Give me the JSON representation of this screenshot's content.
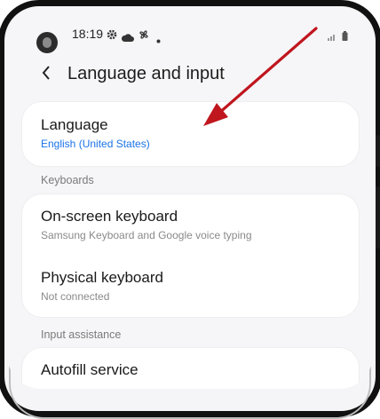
{
  "status_bar": {
    "time": "18:19",
    "icons": [
      "gear-icon",
      "cloud-icon",
      "fan-icon",
      "dot-icon"
    ],
    "right_icons": [
      "signal-icon",
      "battery-icon"
    ]
  },
  "header": {
    "back_icon": "chevron-left-icon",
    "title": "Language and input"
  },
  "language": {
    "title": "Language",
    "value": "English (United States)"
  },
  "keyboards": {
    "section_label": "Keyboards",
    "items": [
      {
        "title": "On-screen keyboard",
        "subtitle": "Samsung Keyboard and Google voice typing"
      },
      {
        "title": "Physical keyboard",
        "subtitle": "Not connected"
      }
    ]
  },
  "input_assistance": {
    "section_label": "Input assistance",
    "items": [
      {
        "title": "Autofill service"
      }
    ]
  },
  "colors": {
    "accent_blue": "#1a73e8",
    "arrow_red": "#c0161e",
    "frame": "#111111",
    "background": "#f6f6f8"
  }
}
